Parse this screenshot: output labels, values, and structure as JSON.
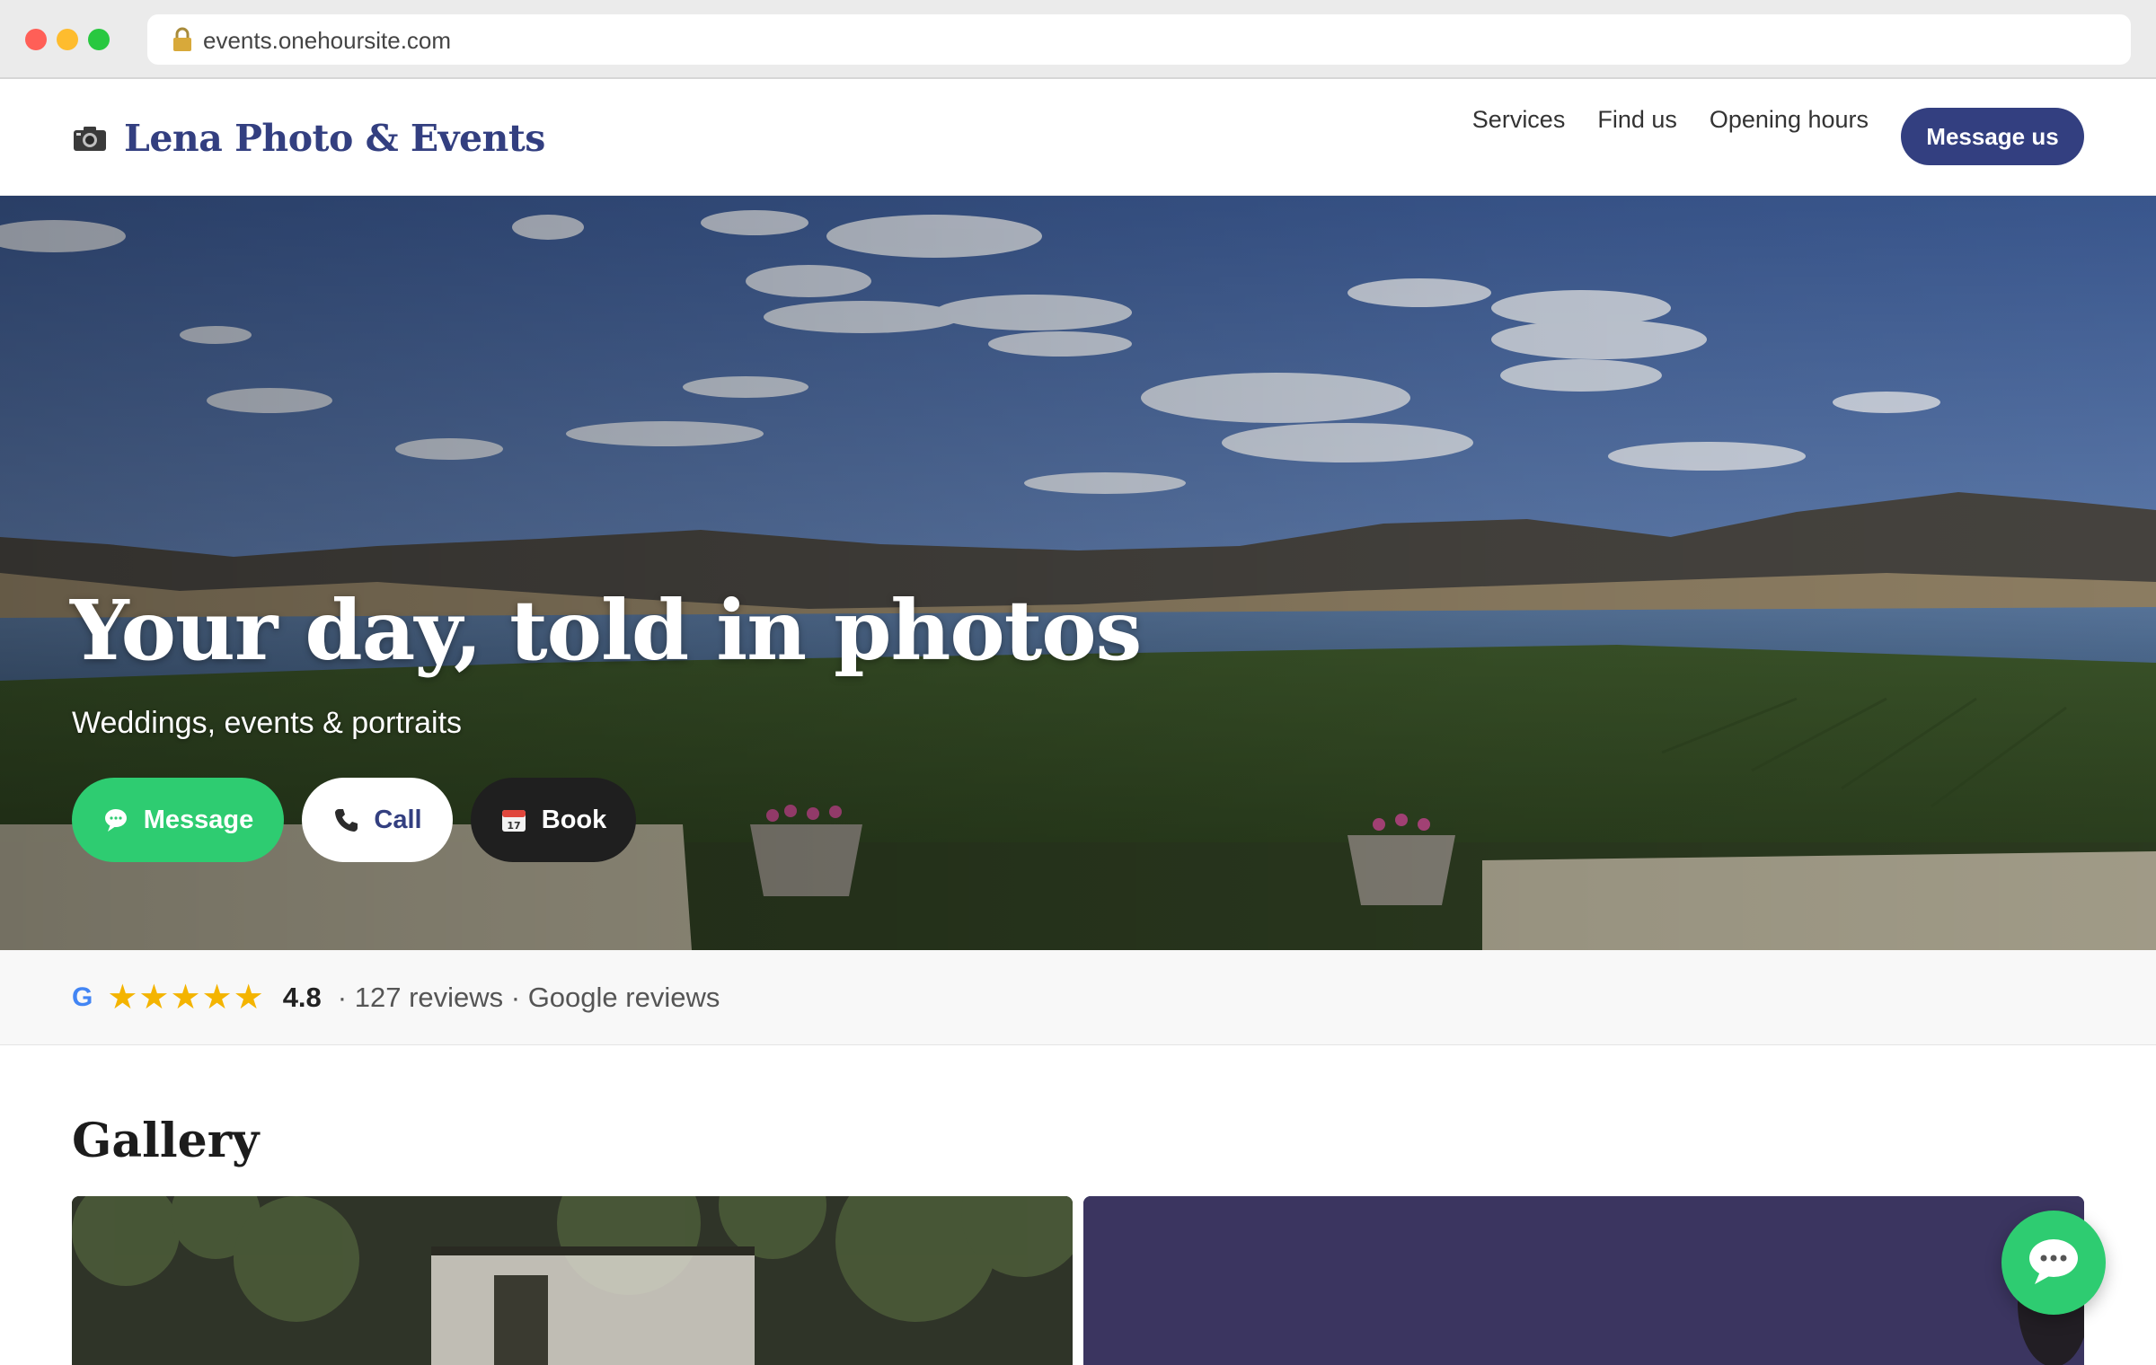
{
  "browser": {
    "url": "events.onehoursite.com",
    "icons": {
      "lock": "lock-icon"
    }
  },
  "header": {
    "brand_icon": "camera-icon",
    "brand_name": "Lena Photo & Events",
    "nav": [
      {
        "label": "Services"
      },
      {
        "label": "Find us"
      },
      {
        "label": "Opening hours"
      }
    ],
    "cta_label": "Message us"
  },
  "hero": {
    "title": "Your day, told in photos",
    "subtitle": "Weddings, events & portraits",
    "buttons": {
      "message": {
        "label": "Message",
        "icon": "speech-bubble-icon"
      },
      "call": {
        "label": "Call",
        "icon": "phone-icon"
      },
      "book": {
        "label": "Book",
        "icon": "calendar-icon",
        "icon_text": "17"
      }
    }
  },
  "reviews": {
    "logo": "G",
    "stars": "★★★★★",
    "rating": "4.8",
    "meta": "· 127 reviews · Google reviews"
  },
  "gallery": {
    "title": "Gallery"
  },
  "chat": {
    "icon": "chat-bubble-icon"
  },
  "colors": {
    "brand": "#333f80",
    "message_green": "#2ecc71",
    "star": "#f4b400",
    "google_blue": "#4285f4"
  }
}
